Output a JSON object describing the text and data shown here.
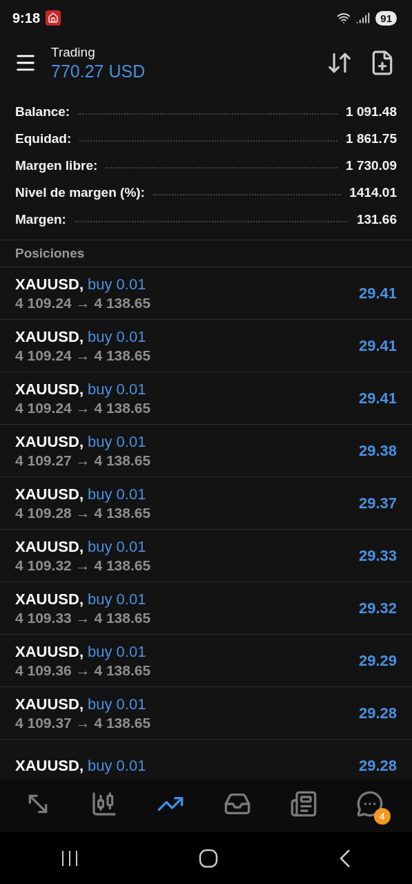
{
  "status_bar": {
    "time": "9:18",
    "battery": "91"
  },
  "header": {
    "title": "Trading",
    "balance": "770.27 USD"
  },
  "summary": [
    {
      "label": "Balance:",
      "value": "1 091.48"
    },
    {
      "label": "Equidad:",
      "value": "1 861.75"
    },
    {
      "label": "Margen libre:",
      "value": "1 730.09"
    },
    {
      "label": "Nivel de margen (%):",
      "value": "1414.01"
    },
    {
      "label": "Margen:",
      "value": "131.66"
    }
  ],
  "section_title": "Posiciones",
  "positions": [
    {
      "symbol": "XAUUSD,",
      "order": "buy 0.01",
      "prices": "4 109.24 → 4 138.65",
      "profit": "29.41"
    },
    {
      "symbol": "XAUUSD,",
      "order": "buy 0.01",
      "prices": "4 109.24 → 4 138.65",
      "profit": "29.41"
    },
    {
      "symbol": "XAUUSD,",
      "order": "buy 0.01",
      "prices": "4 109.24 → 4 138.65",
      "profit": "29.41"
    },
    {
      "symbol": "XAUUSD,",
      "order": "buy 0.01",
      "prices": "4 109.27 → 4 138.65",
      "profit": "29.38"
    },
    {
      "symbol": "XAUUSD,",
      "order": "buy 0.01",
      "prices": "4 109.28 → 4 138.65",
      "profit": "29.37"
    },
    {
      "symbol": "XAUUSD,",
      "order": "buy 0.01",
      "prices": "4 109.32 → 4 138.65",
      "profit": "29.33"
    },
    {
      "symbol": "XAUUSD,",
      "order": "buy 0.01",
      "prices": "4 109.33 → 4 138.65",
      "profit": "29.32"
    },
    {
      "symbol": "XAUUSD,",
      "order": "buy 0.01",
      "prices": "4 109.36 → 4 138.65",
      "profit": "29.29"
    },
    {
      "symbol": "XAUUSD,",
      "order": "buy 0.01",
      "prices": "4 109.37 → 4 138.65",
      "profit": "29.28"
    },
    {
      "symbol": "XAUUSD,",
      "order": "buy 0.01",
      "profit": "29.28"
    }
  ],
  "bottom_nav": [
    {
      "kind": "quotes",
      "selected": false
    },
    {
      "kind": "chart",
      "selected": false
    },
    {
      "kind": "trade",
      "selected": true
    },
    {
      "kind": "history",
      "selected": false
    },
    {
      "kind": "news",
      "selected": false
    },
    {
      "kind": "messages",
      "selected": false,
      "badge": "4"
    }
  ]
}
